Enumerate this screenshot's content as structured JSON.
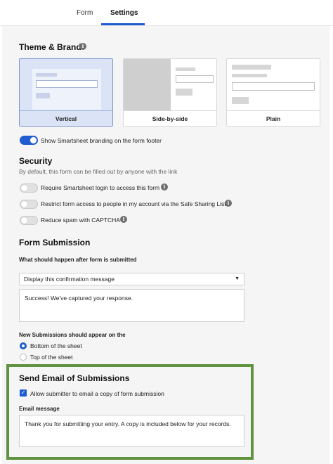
{
  "tabs": {
    "form": "Form",
    "settings": "Settings"
  },
  "theme": {
    "title": "Theme & Brand",
    "cards": [
      "Vertical",
      "Side-by-side",
      "Plain"
    ],
    "branding_toggle": {
      "label": "Show Smartsheet branding on the form footer",
      "on": true
    }
  },
  "security": {
    "title": "Security",
    "subtitle": "By default, this form can be filled out by anyone with the link",
    "options": [
      {
        "label": "Require Smartsheet login to access this form",
        "on": false
      },
      {
        "label": "Restrict form access to people in my account via the Safe Sharing List",
        "on": false
      },
      {
        "label": "Reduce spam with CAPTCHA",
        "on": false
      }
    ]
  },
  "submission": {
    "title": "Form Submission",
    "question": "What should happen after form is submitted",
    "select_value": "Display this confirmation message",
    "message": "Success! We've captured your response.",
    "new_label": "New Submissions should appear on the",
    "radio_bottom": "Bottom of the sheet",
    "radio_top": "Top of the sheet",
    "selected": "bottom"
  },
  "email": {
    "title": "Send Email of Submissions",
    "checkbox_label": "Allow submitter to email a copy of form submission",
    "checked": true,
    "message_label": "Email message",
    "message": "Thank you for submitting your entry. A copy is included below for your records."
  },
  "colors": {
    "accent": "#1f5bd1",
    "highlight": "#5f9340"
  },
  "icons": [
    "info-icon",
    "chevron-down-icon",
    "check-icon"
  ]
}
